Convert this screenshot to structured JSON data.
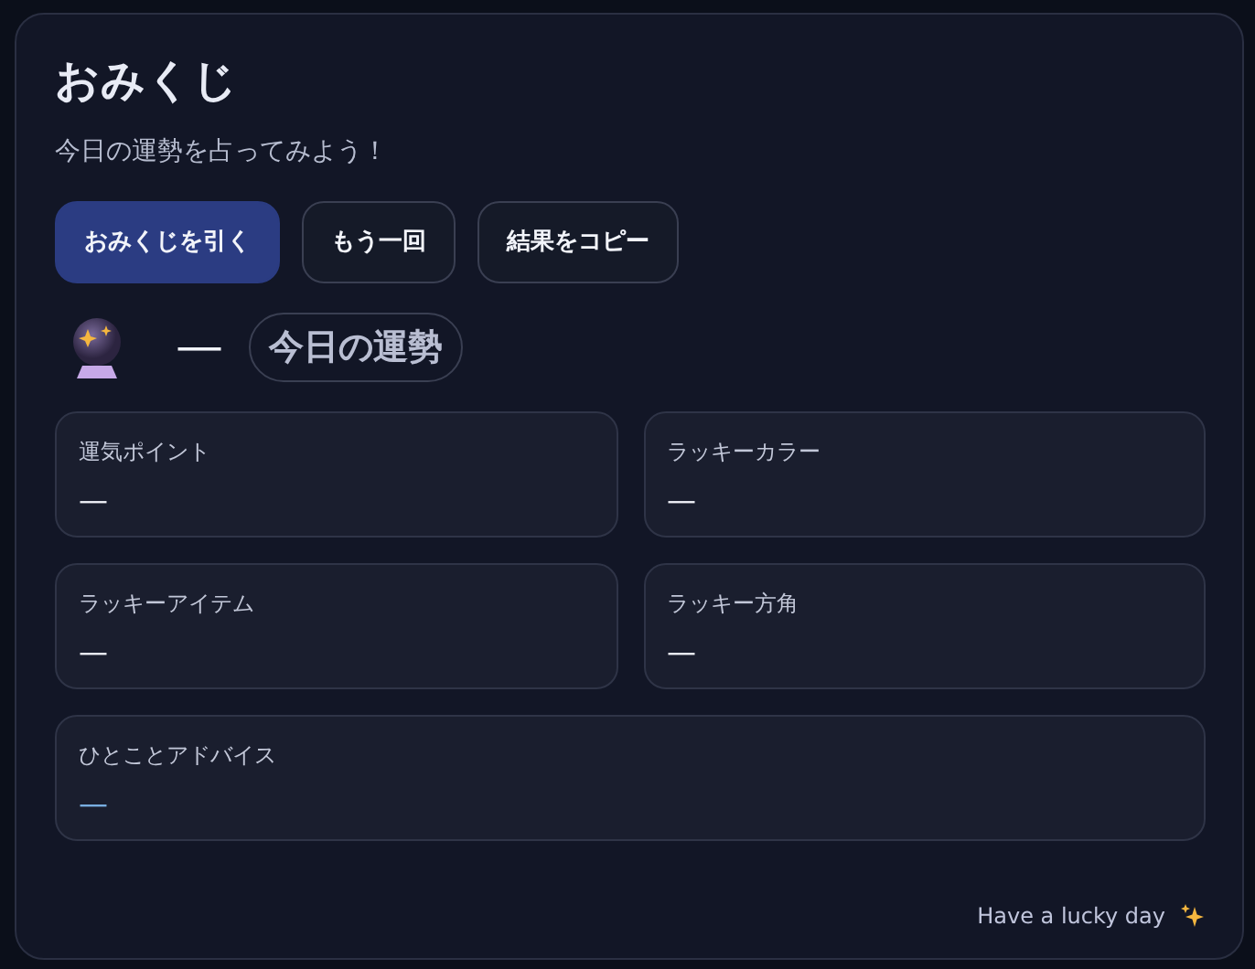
{
  "app": {
    "title": "おみくじ",
    "subtitle": "今日の運勢を占ってみよう！"
  },
  "buttons": [
    {
      "label": "おみくじを引く",
      "kind": "primary"
    },
    {
      "label": "もう一回",
      "kind": "outline"
    },
    {
      "label": "結果をコピー",
      "kind": "outline"
    }
  ],
  "result": {
    "fortune": "—",
    "badge": "今日の運勢"
  },
  "cards": [
    {
      "label": "運気ポイント",
      "value": "—",
      "kind": "half"
    },
    {
      "label": "ラッキーカラー",
      "value": "—",
      "kind": "half"
    },
    {
      "label": "ラッキーアイテム",
      "value": "—",
      "kind": "half"
    },
    {
      "label": "ラッキー方角",
      "value": "—",
      "kind": "half"
    },
    {
      "label": "ひとことアドバイス",
      "value": "—",
      "kind": "advice"
    }
  ],
  "footer": {
    "text": "Have a lucky day"
  }
}
